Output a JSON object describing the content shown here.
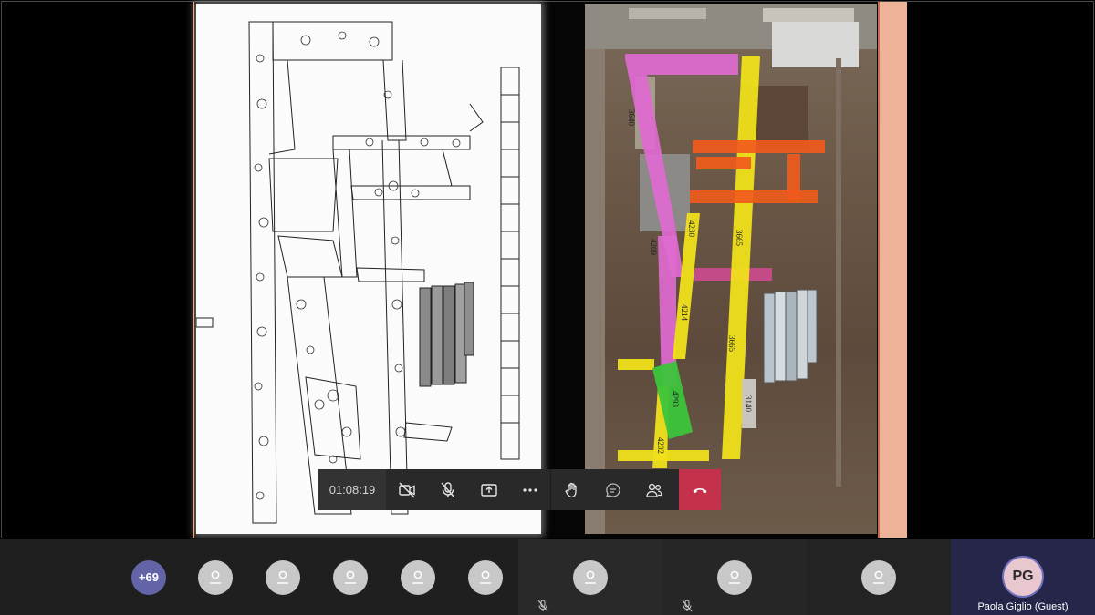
{
  "call": {
    "timer": "01:08:19",
    "overflow_count": "+69"
  },
  "controls": {
    "camera_icon": "camera-off-icon",
    "mic_icon": "mic-off-icon",
    "share_icon": "share-screen-icon",
    "more_icon": "more-icon",
    "raise_hand_icon": "raise-hand-icon",
    "chat_icon": "chat-icon",
    "participants_icon": "participants-icon",
    "hangup_icon": "hang-up-icon"
  },
  "shared_content": {
    "photo_labels": [
      "3276",
      "3640",
      "4230",
      "3665",
      "3665",
      "4214",
      "4209",
      "4293",
      "4202",
      "3140"
    ]
  },
  "participants": {
    "featured": {
      "initials": "PG",
      "name": "Paola Giglio (Guest)"
    }
  },
  "colors": {
    "accent": "#6264a7",
    "hangup": "#c4314b",
    "avatar_grey": "#c8c8c8",
    "pg_avatar": "#e9c7cf"
  }
}
